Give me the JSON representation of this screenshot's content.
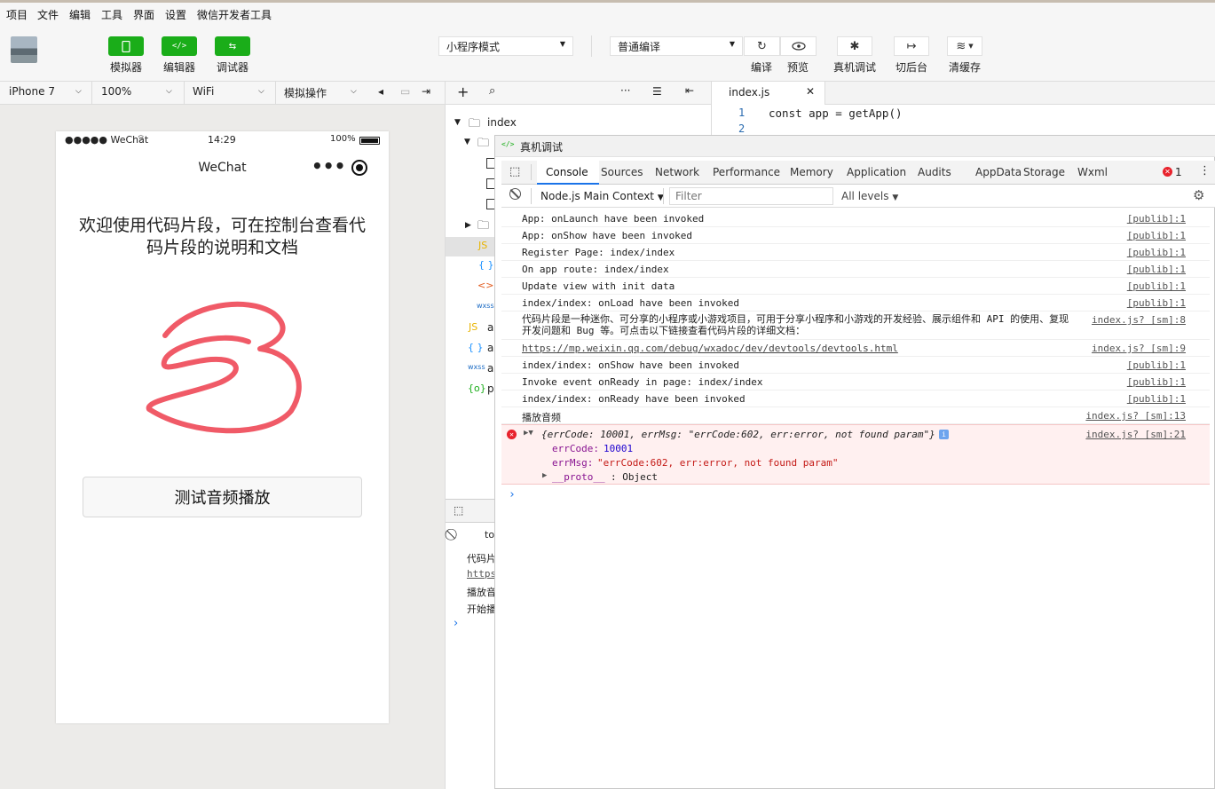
{
  "menu": [
    "项目",
    "文件",
    "编辑",
    "工具",
    "界面",
    "设置",
    "微信开发者工具"
  ],
  "toolbar": {
    "simulator": "模拟器",
    "editor": "编辑器",
    "debugger": "调试器",
    "mode": "小程序模式",
    "compile_mode": "普通编译",
    "compile": "编译",
    "preview": "预览",
    "remote_debug": "真机调试",
    "background": "切后台",
    "clear_cache": "清缓存"
  },
  "subbar": {
    "device": "iPhone 7",
    "zoom": "100%",
    "network": "WiFi",
    "operation": "模拟操作"
  },
  "phone": {
    "carrier": "●●●●● WeChat",
    "time": "14:29",
    "battery": "100%",
    "nav_title": "WeChat",
    "nav_dots": "•••",
    "welcome": "欢迎使用代码片段，可在控制台查看代码片段的说明和文档",
    "test_button": "测试音频播放"
  },
  "tree": {
    "root": "index",
    "items": [
      "a",
      "a",
      "a",
      "p"
    ],
    "left_console_lines": [
      "代码片",
      "https",
      "播放音",
      "开始播"
    ],
    "filter_short": "to"
  },
  "editor": {
    "tab": "index.js",
    "line1_no": "1",
    "line2_no": "2",
    "line1": "const app = getApp()"
  },
  "devtools": {
    "title": "真机调试",
    "tabs": [
      "Console",
      "Sources",
      "Network",
      "Performance",
      "Memory",
      "Application",
      "Audits",
      "AppData",
      "Storage",
      "Wxml"
    ],
    "error_count": "1",
    "context": "Node.js Main Context",
    "filter_placeholder": "Filter",
    "levels": "All levels",
    "logs": [
      {
        "msg": "App: onLaunch have been invoked",
        "src": "[publib]:1"
      },
      {
        "msg": "App: onShow have been invoked",
        "src": "[publib]:1"
      },
      {
        "msg": "Register Page: index/index",
        "src": "[publib]:1"
      },
      {
        "msg": "On app route: index/index",
        "src": "[publib]:1"
      },
      {
        "msg": "Update view with init data",
        "src": "[publib]:1"
      },
      {
        "msg": "index/index: onLoad have been invoked",
        "src": "[publib]:1"
      },
      {
        "msg": "代码片段是一种迷你、可分享的小程序或小游戏项目，可用于分享小程序和小游戏的开发经验、展示组件和 API 的使用、复现开发问题和 Bug 等。可点击以下链接查看代码片段的详细文档：",
        "src": "index.js? [sm]:8"
      },
      {
        "msg": "https://mp.weixin.qq.com/debug/wxadoc/dev/devtools/devtools.html",
        "src": "index.js? [sm]:9"
      },
      {
        "msg": "index/index: onShow have been invoked",
        "src": "[publib]:1"
      },
      {
        "msg": "Invoke event onReady in page: index/index",
        "src": "[publib]:1"
      },
      {
        "msg": "index/index: onReady have been invoked",
        "src": "[publib]:1"
      },
      {
        "msg": "播放音频",
        "src": "index.js? [sm]:13"
      }
    ],
    "error": {
      "summary": "{errCode: 10001, errMsg: \"errCode:602, err:error, not found param\"}",
      "src": "index.js? [sm]:21",
      "errcode_key": "errCode:",
      "errcode_val": "10001",
      "errmsg_key": "errMsg:",
      "errmsg_val": "\"errCode:602, err:error, not found param\"",
      "proto_key": "__proto__",
      "proto_val": ": Object"
    },
    "prompt": "›"
  },
  "colors": {
    "wechat_green": "#1aad19",
    "logo_red": "#f05a67",
    "error_bg": "#fff0f0",
    "error_text": "#e8222c",
    "link": "#1a1aa6"
  }
}
